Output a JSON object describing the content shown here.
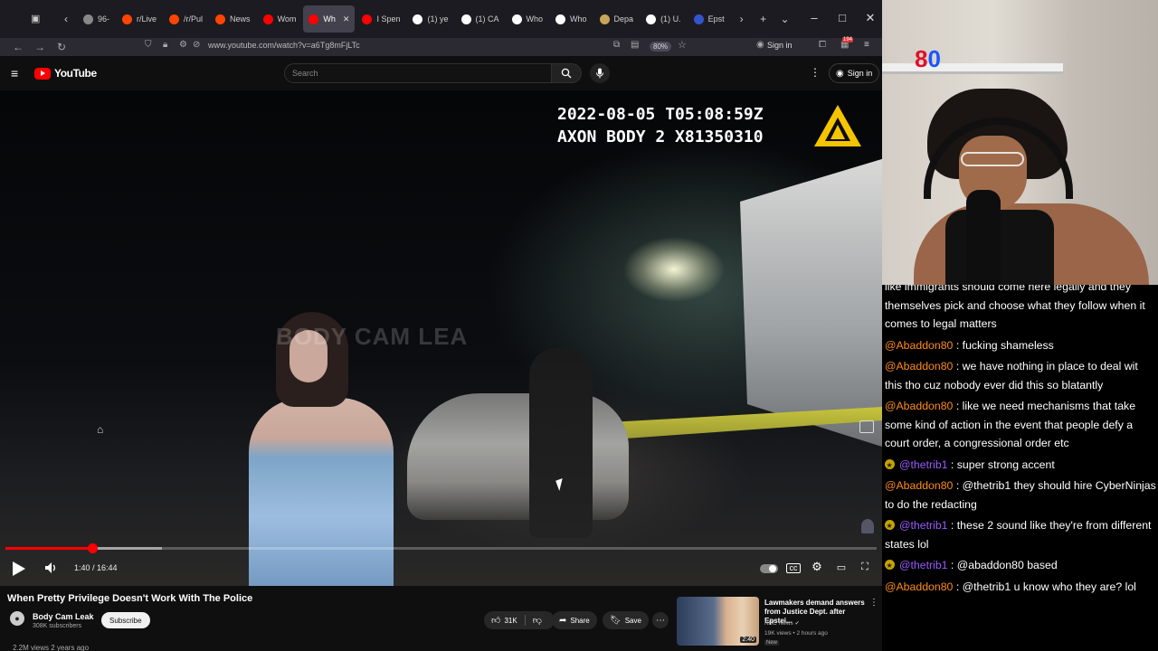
{
  "browser": {
    "tabs": [
      {
        "label": "96-",
        "fav": "#888"
      },
      {
        "label": "r/Live",
        "fav": "#ff4500"
      },
      {
        "label": "/r/Pul",
        "fav": "#ff4500"
      },
      {
        "label": "News",
        "fav": "#ff4500"
      },
      {
        "label": "Wom",
        "fav": "#ff0000"
      },
      {
        "label": "Wh",
        "fav": "#ff0000",
        "active": true
      },
      {
        "label": "I Spen",
        "fav": "#ff0000"
      },
      {
        "label": "(1) ye",
        "fav": "#ffffff"
      },
      {
        "label": "(1) CA",
        "fav": "#ffffff"
      },
      {
        "label": "Who",
        "fav": "#ffffff"
      },
      {
        "label": "Who",
        "fav": "#ffffff"
      },
      {
        "label": "Depa",
        "fav": "#c7a45a"
      },
      {
        "label": "(1) U.",
        "fav": "#ffffff"
      },
      {
        "label": "Epst",
        "fav": "#3355cc"
      }
    ],
    "url": "www.youtube.com/watch?v=a6Tg8mFjLTc",
    "zoom": "80%",
    "sign_in": "Sign in",
    "badge_count": "194"
  },
  "youtube": {
    "logo": "YouTube",
    "search_placeholder": "Search",
    "sign_in": "Sign in"
  },
  "video": {
    "cam_timestamp": "2022-08-05 T05:08:59Z",
    "cam_device": "AXON BODY 2 X81350310",
    "watermark": "BODY CAM LEA",
    "time_current": "1:40",
    "time_total": "16:44",
    "time_display": "1:40 / 16:44",
    "progress_fraction": 0.1,
    "buffered_fraction": 0.18
  },
  "details": {
    "title": "When Pretty Privilege Doesn't Work With The Police",
    "channel": "Body Cam Leak",
    "subscribers": "308K subscribers",
    "subscribe_label": "Subscribe",
    "likes": "31K",
    "share_label": "Share",
    "save_label": "Save",
    "views_line": "2.2M views  2 years ago"
  },
  "recommended": {
    "title": "Lawmakers demand answers from Justice Dept. after Epstei...",
    "channel": "NBC News",
    "meta": "19K views • 2 hours ago",
    "badge": "New",
    "duration": "2:40"
  },
  "webcam": {
    "logo_part1": "8",
    "logo_part2": "0"
  },
  "chat": [
    {
      "user": "",
      "text": "like immigrants should come here legally and they themselves pick and choose what they follow when it comes to legal matters",
      "badge": false,
      "color": "#fff"
    },
    {
      "user": "@Abaddon80",
      "text": " : fucking shameless",
      "badge": false,
      "color": "#ff8c1a"
    },
    {
      "user": "@Abaddon80",
      "text": " : we have nothing in place to deal wit this tho cuz nobody ever did this so blatantly",
      "badge": false,
      "color": "#ff8c1a"
    },
    {
      "user": "@Abaddon80",
      "text": " : like we need mechanisms that take some kind of action in the event that people defy a court order, a congressional order etc",
      "badge": false,
      "color": "#ff8c1a"
    },
    {
      "user": "@thetrib1",
      "text": " : super strong accent",
      "badge": true,
      "color": "#9a5cff"
    },
    {
      "user": "@Abaddon80",
      "text": " : @thetrib1 they should hire CyberNinjas to do the redacting",
      "badge": false,
      "color": "#ff8c1a"
    },
    {
      "user": "@thetrib1",
      "text": " : these 2 sound like they're from different states lol",
      "badge": true,
      "color": "#9a5cff"
    },
    {
      "user": "@thetrib1",
      "text": " : @abaddon80 based",
      "badge": true,
      "color": "#9a5cff"
    },
    {
      "user": "@Abaddon80",
      "text": " : @thetrib1 u know who they are? lol",
      "badge": false,
      "color": "#ff8c1a"
    }
  ],
  "colors": {
    "yt_red": "#ff0000",
    "chat_user_a": "#ff8c1a",
    "chat_user_b": "#9a5cff"
  }
}
